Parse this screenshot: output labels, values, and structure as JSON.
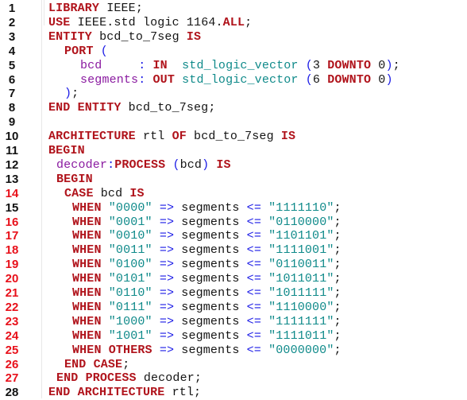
{
  "editor": {
    "language": "VHDL",
    "error_line_color": "#e8101a",
    "normal_line_color": "#111111",
    "token_colors": {
      "keyword": "#b0131b",
      "identifier": "#141414",
      "port": "#8a1aa0",
      "type": "#0f8a8a",
      "string": "#0f8a8a",
      "operator": "#1a1ae6"
    },
    "lines": [
      {
        "n": "1",
        "error": false,
        "indent": 2,
        "tokens": [
          [
            "kw",
            "LIBRARY"
          ],
          [
            "id",
            " IEEE;"
          ]
        ]
      },
      {
        "n": "2",
        "error": false,
        "indent": 2,
        "tokens": [
          [
            "kw",
            "USE"
          ],
          [
            "id",
            " IEEE.std logic 1164."
          ],
          [
            "kw",
            "ALL"
          ],
          [
            "id",
            ";"
          ]
        ]
      },
      {
        "n": "3",
        "error": false,
        "indent": 2,
        "tokens": [
          [
            "kw",
            "ENTITY"
          ],
          [
            "id",
            " bcd_to_7seg "
          ],
          [
            "kw",
            "IS"
          ]
        ]
      },
      {
        "n": "4",
        "error": false,
        "indent": 6,
        "tokens": [
          [
            "kw",
            "PORT"
          ],
          [
            "id",
            " "
          ],
          [
            "op",
            "("
          ]
        ]
      },
      {
        "n": "5",
        "error": false,
        "indent": 10,
        "tokens": [
          [
            "port",
            "bcd     "
          ],
          [
            "op",
            ":"
          ],
          [
            "id",
            " "
          ],
          [
            "kw",
            "IN"
          ],
          [
            "id",
            "  "
          ],
          [
            "type",
            "std_logic_vector"
          ],
          [
            "id",
            " "
          ],
          [
            "op",
            "("
          ],
          [
            "num",
            "3 "
          ],
          [
            "kw",
            "DOWNTO"
          ],
          [
            "num",
            " 0"
          ],
          [
            "op",
            ")"
          ],
          [
            "id",
            ";"
          ]
        ]
      },
      {
        "n": "6",
        "error": false,
        "indent": 10,
        "tokens": [
          [
            "port",
            "segments"
          ],
          [
            "op",
            ":"
          ],
          [
            "id",
            " "
          ],
          [
            "kw",
            "OUT"
          ],
          [
            "id",
            " "
          ],
          [
            "type",
            "std_logic_vector"
          ],
          [
            "id",
            " "
          ],
          [
            "op",
            "("
          ],
          [
            "num",
            "6 "
          ],
          [
            "kw",
            "DOWNTO"
          ],
          [
            "num",
            " 0"
          ],
          [
            "op",
            ")"
          ]
        ]
      },
      {
        "n": "7",
        "error": false,
        "indent": 6,
        "tokens": [
          [
            "op",
            ")"
          ],
          [
            "id",
            ";"
          ]
        ]
      },
      {
        "n": "8",
        "error": false,
        "indent": 2,
        "tokens": [
          [
            "kw",
            "END ENTITY"
          ],
          [
            "id",
            " bcd_to_7seg;"
          ]
        ]
      },
      {
        "n": "9",
        "error": false,
        "indent": 2,
        "tokens": []
      },
      {
        "n": "10",
        "error": false,
        "indent": 2,
        "tokens": [
          [
            "kw",
            "ARCHITECTURE"
          ],
          [
            "id",
            " rtl "
          ],
          [
            "kw",
            "OF"
          ],
          [
            "id",
            " bcd_to_7seg "
          ],
          [
            "kw",
            "IS"
          ]
        ]
      },
      {
        "n": "11",
        "error": false,
        "indent": 2,
        "tokens": [
          [
            "kw",
            "BEGIN"
          ]
        ]
      },
      {
        "n": "12",
        "error": false,
        "indent": 4,
        "tokens": [
          [
            "port",
            "decoder"
          ],
          [
            "op",
            ":"
          ],
          [
            "kw",
            "PROCESS"
          ],
          [
            "id",
            " "
          ],
          [
            "op",
            "("
          ],
          [
            "id",
            "bcd"
          ],
          [
            "op",
            ")"
          ],
          [
            "id",
            " "
          ],
          [
            "kw",
            "IS"
          ]
        ]
      },
      {
        "n": "13",
        "error": false,
        "indent": 4,
        "tokens": [
          [
            "kw",
            "BEGIN"
          ]
        ]
      },
      {
        "n": "14",
        "error": true,
        "indent": 6,
        "tokens": [
          [
            "kw",
            "CASE"
          ],
          [
            "id",
            " bcd "
          ],
          [
            "kw",
            "IS"
          ]
        ]
      },
      {
        "n": "15",
        "error": false,
        "indent": 8,
        "tokens": [
          [
            "kw",
            "WHEN"
          ],
          [
            "id",
            " "
          ],
          [
            "str",
            "\"0000\""
          ],
          [
            "id",
            " "
          ],
          [
            "op",
            "=>"
          ],
          [
            "id",
            " segments "
          ],
          [
            "op",
            "<="
          ],
          [
            "id",
            " "
          ],
          [
            "str",
            "\"1111110\""
          ],
          [
            "id",
            ";"
          ]
        ]
      },
      {
        "n": "16",
        "error": true,
        "indent": 8,
        "tokens": [
          [
            "kw",
            "WHEN"
          ],
          [
            "id",
            " "
          ],
          [
            "str",
            "\"0001\""
          ],
          [
            "id",
            " "
          ],
          [
            "op",
            "=>"
          ],
          [
            "id",
            " segments "
          ],
          [
            "op",
            "<="
          ],
          [
            "id",
            " "
          ],
          [
            "str",
            "\"0110000\""
          ],
          [
            "id",
            ";"
          ]
        ]
      },
      {
        "n": "17",
        "error": true,
        "indent": 8,
        "tokens": [
          [
            "kw",
            "WHEN"
          ],
          [
            "id",
            " "
          ],
          [
            "str",
            "\"0010\""
          ],
          [
            "id",
            " "
          ],
          [
            "op",
            "=>"
          ],
          [
            "id",
            " segments "
          ],
          [
            "op",
            "<="
          ],
          [
            "id",
            " "
          ],
          [
            "str",
            "\"1101101\""
          ],
          [
            "id",
            ";"
          ]
        ]
      },
      {
        "n": "18",
        "error": true,
        "indent": 8,
        "tokens": [
          [
            "kw",
            "WHEN"
          ],
          [
            "id",
            " "
          ],
          [
            "str",
            "\"0011\""
          ],
          [
            "id",
            " "
          ],
          [
            "op",
            "=>"
          ],
          [
            "id",
            " segments "
          ],
          [
            "op",
            "<="
          ],
          [
            "id",
            " "
          ],
          [
            "str",
            "\"1111001\""
          ],
          [
            "id",
            ";"
          ]
        ]
      },
      {
        "n": "19",
        "error": true,
        "indent": 8,
        "tokens": [
          [
            "kw",
            "WHEN"
          ],
          [
            "id",
            " "
          ],
          [
            "str",
            "\"0100\""
          ],
          [
            "id",
            " "
          ],
          [
            "op",
            "=>"
          ],
          [
            "id",
            " segments "
          ],
          [
            "op",
            "<="
          ],
          [
            "id",
            " "
          ],
          [
            "str",
            "\"0110011\""
          ],
          [
            "id",
            ";"
          ]
        ]
      },
      {
        "n": "20",
        "error": true,
        "indent": 8,
        "tokens": [
          [
            "kw",
            "WHEN"
          ],
          [
            "id",
            " "
          ],
          [
            "str",
            "\"0101\""
          ],
          [
            "id",
            " "
          ],
          [
            "op",
            "=>"
          ],
          [
            "id",
            " segments "
          ],
          [
            "op",
            "<="
          ],
          [
            "id",
            " "
          ],
          [
            "str",
            "\"1011011\""
          ],
          [
            "id",
            ";"
          ]
        ]
      },
      {
        "n": "21",
        "error": true,
        "indent": 8,
        "tokens": [
          [
            "kw",
            "WHEN"
          ],
          [
            "id",
            " "
          ],
          [
            "str",
            "\"0110\""
          ],
          [
            "id",
            " "
          ],
          [
            "op",
            "=>"
          ],
          [
            "id",
            " segments "
          ],
          [
            "op",
            "<="
          ],
          [
            "id",
            " "
          ],
          [
            "str",
            "\"1011111\""
          ],
          [
            "id",
            ";"
          ]
        ]
      },
      {
        "n": "22",
        "error": true,
        "indent": 8,
        "tokens": [
          [
            "kw",
            "WHEN"
          ],
          [
            "id",
            " "
          ],
          [
            "str",
            "\"0111\""
          ],
          [
            "id",
            " "
          ],
          [
            "op",
            "=>"
          ],
          [
            "id",
            " segments "
          ],
          [
            "op",
            "<="
          ],
          [
            "id",
            " "
          ],
          [
            "str",
            "\"1110000\""
          ],
          [
            "id",
            ";"
          ]
        ]
      },
      {
        "n": "23",
        "error": true,
        "indent": 8,
        "tokens": [
          [
            "kw",
            "WHEN"
          ],
          [
            "id",
            " "
          ],
          [
            "str",
            "\"1000\""
          ],
          [
            "id",
            " "
          ],
          [
            "op",
            "=>"
          ],
          [
            "id",
            " segments "
          ],
          [
            "op",
            "<="
          ],
          [
            "id",
            " "
          ],
          [
            "str",
            "\"1111111\""
          ],
          [
            "id",
            ";"
          ]
        ]
      },
      {
        "n": "24",
        "error": true,
        "indent": 8,
        "tokens": [
          [
            "kw",
            "WHEN"
          ],
          [
            "id",
            " "
          ],
          [
            "str",
            "\"1001\""
          ],
          [
            "id",
            " "
          ],
          [
            "op",
            "=>"
          ],
          [
            "id",
            " segments "
          ],
          [
            "op",
            "<="
          ],
          [
            "id",
            " "
          ],
          [
            "str",
            "\"1111011\""
          ],
          [
            "id",
            ";"
          ]
        ]
      },
      {
        "n": "25",
        "error": true,
        "indent": 8,
        "tokens": [
          [
            "kw",
            "WHEN OTHERS"
          ],
          [
            "id",
            " "
          ],
          [
            "op",
            "=>"
          ],
          [
            "id",
            " segments "
          ],
          [
            "op",
            "<="
          ],
          [
            "id",
            " "
          ],
          [
            "str",
            "\"0000000\""
          ],
          [
            "id",
            ";"
          ]
        ]
      },
      {
        "n": "26",
        "error": true,
        "indent": 6,
        "tokens": [
          [
            "kw",
            "END CASE"
          ],
          [
            "id",
            ";"
          ]
        ]
      },
      {
        "n": "27",
        "error": true,
        "indent": 4,
        "tokens": [
          [
            "kw",
            "END PROCESS"
          ],
          [
            "id",
            " decoder;"
          ]
        ]
      },
      {
        "n": "28",
        "error": false,
        "indent": 2,
        "tokens": [
          [
            "kw",
            "END ARCHITECTURE"
          ],
          [
            "id",
            " rtl;"
          ]
        ]
      }
    ]
  }
}
